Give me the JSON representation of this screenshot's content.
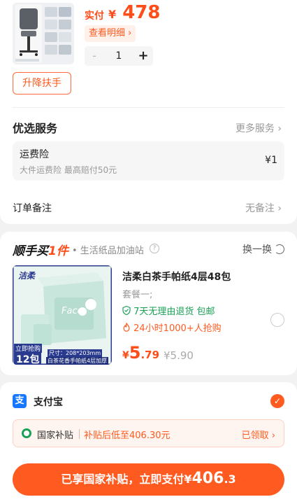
{
  "product": {
    "price_label": "实付",
    "price_symbol": "¥",
    "price": "478",
    "detail_button": "查看明细",
    "detail_chevron": "›",
    "quantity": "1",
    "minus": "-",
    "plus": "+",
    "option_button": "升降扶手"
  },
  "services": {
    "title": "优选服务",
    "more_link": "更多服务",
    "chevron": "›",
    "insurance": {
      "name": "运费险",
      "desc": "大件运费险 最高赔付50元",
      "price": "¥1"
    }
  },
  "order_note": {
    "label": "订单备注",
    "value": "无备注",
    "chevron": "›"
  },
  "recommend": {
    "brand_prefix": "顺手买",
    "brand_suffix": "1件",
    "subtitle": "• 生活纸品加油站",
    "help": "?",
    "swap": "换一换",
    "item": {
      "title": "洁柔白茶手帕纸4层48包",
      "package": "套餐一;",
      "return_policy": "7天无理由退货  包邮",
      "hot": "24小时1000+人抢购",
      "price_symbol": "¥",
      "price_int": "5",
      "price_dec": ".79",
      "old_price": "¥5.90",
      "img_brand": "洁柔",
      "img_face": "Face",
      "img_promo_top": "立即抢购",
      "img_promo_count": "12包",
      "img_size": "尺寸：208*203mm",
      "img_desc": "白茶花香手帕纸4层加厚"
    }
  },
  "payment": {
    "method_icon": "支",
    "method": "支付宝",
    "check": "✓",
    "subsidy": {
      "name": "国家补贴",
      "desc": "补贴后低至406.30元",
      "status": "已领取",
      "chevron": "›"
    },
    "button_text": "已享国家补贴，立即支付",
    "button_symbol": "¥",
    "button_amount": "406",
    "button_decimal": ".3"
  },
  "colors": {
    "accent": "#ff5a1f",
    "price": "#ff4d1a",
    "green": "#19a055",
    "alipay": "#1677ff"
  }
}
